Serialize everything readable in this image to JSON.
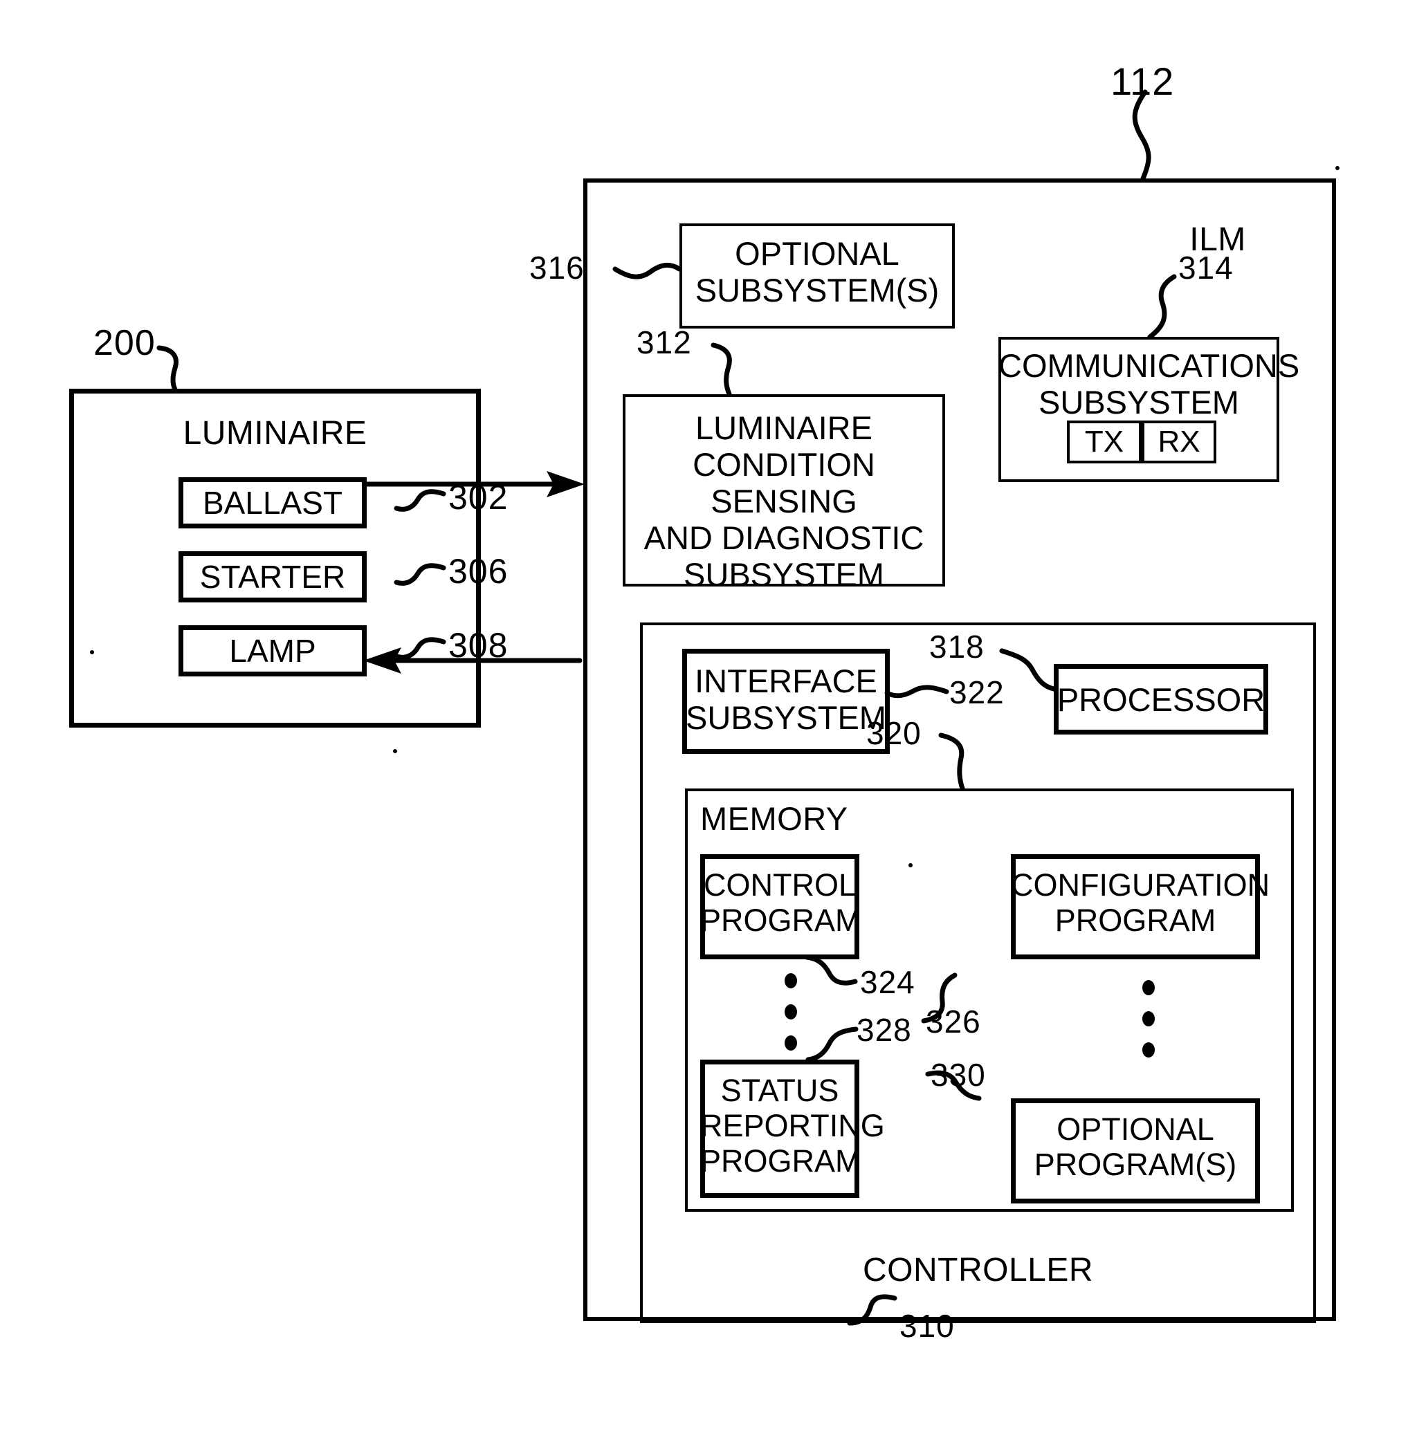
{
  "figure": {
    "type": "patent-block-diagram",
    "title_refs": {
      "ilm": "112",
      "luminaire": "200",
      "ballast": "302",
      "starter": "306",
      "lamp": "308",
      "controller": "310",
      "sensing_subsystem": "312",
      "communications_subsystem": "314",
      "optional_subsystems": "316",
      "processor": "318",
      "memory": "320",
      "interface_subsystem": "322",
      "control_program": "324",
      "configuration_program": "326",
      "status_reporting_program": "328",
      "optional_programs": "330"
    }
  },
  "luminaire": {
    "title": "LUMINAIRE",
    "ref": "200",
    "components": [
      {
        "label": "BALLAST",
        "ref": "302"
      },
      {
        "label": "STARTER",
        "ref": "306"
      },
      {
        "label": "LAMP",
        "ref": "308"
      }
    ]
  },
  "ilm": {
    "label": "ILM",
    "ref": "112",
    "optional_subsystems": {
      "label": "OPTIONAL\nSUBSYSTEM(S)",
      "ref": "316"
    },
    "sensing_subsystem": {
      "label": "LUMINAIRE\nCONDITION  SENSING\nAND  DIAGNOSTIC\nSUBSYSTEM",
      "ref": "312"
    },
    "communications_subsystem": {
      "label": "COMMUNICATIONS\nSUBSYSTEM",
      "ref": "314",
      "tx_label": "TX",
      "rx_label": "RX"
    },
    "controller": {
      "label": "CONTROLLER",
      "ref": "310",
      "interface_subsystem": {
        "label": "INTERFACE\nSUBSYSTEM",
        "ref": "322"
      },
      "processor": {
        "label": "PROCESSOR",
        "ref": "318"
      },
      "memory": {
        "label": "MEMORY",
        "ref": "320",
        "programs": [
          {
            "label": "CONTROL\nPROGRAM",
            "ref": "324"
          },
          {
            "label": "CONFIGURATION\nPROGRAM",
            "ref": "326"
          },
          {
            "label": "STATUS\nREPORTING\nPROGRAM",
            "ref": "328"
          },
          {
            "label": "OPTIONAL\nPROGRAM(S)",
            "ref": "330"
          }
        ]
      }
    }
  },
  "colors": {
    "ink": "#000000",
    "paper": "#ffffff"
  }
}
